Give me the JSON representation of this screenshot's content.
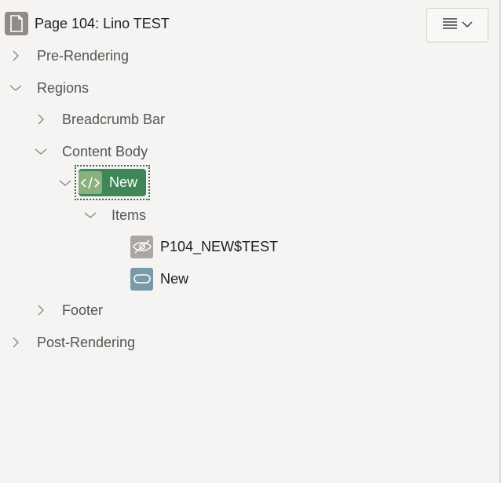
{
  "page": {
    "title": "Page 104: Lino TEST",
    "icon": "page-icon"
  },
  "menu_button": {
    "icons": [
      "hamburger-icon",
      "chevron-down-icon"
    ]
  },
  "tree": {
    "pre_rendering": {
      "label": "Pre-Rendering",
      "expanded": false
    },
    "regions": {
      "label": "Regions",
      "expanded": true
    },
    "breadcrumb_bar": {
      "label": "Breadcrumb Bar",
      "expanded": false
    },
    "content_body": {
      "label": "Content Body",
      "expanded": true
    },
    "new_region": {
      "label": "New",
      "expanded": true,
      "selected": true,
      "icon": "code-icon"
    },
    "items": {
      "label": "Items",
      "expanded": true
    },
    "item_hidden": {
      "label": "P104_NEW$TEST",
      "icon": "eye-slash-icon"
    },
    "item_text": {
      "label": "New",
      "icon": "text-field-icon"
    },
    "footer": {
      "label": "Footer",
      "expanded": false
    },
    "post_rendering": {
      "label": "Post-Rendering",
      "expanded": false
    }
  },
  "colors": {
    "background": "#f5f4f2",
    "selected_region": "#3f8758",
    "selected_region_icon": "#8bb07f",
    "hidden_item_icon": "#aaa7a2",
    "text_item_icon": "#799aa7",
    "page_icon": "#8f8c88"
  }
}
